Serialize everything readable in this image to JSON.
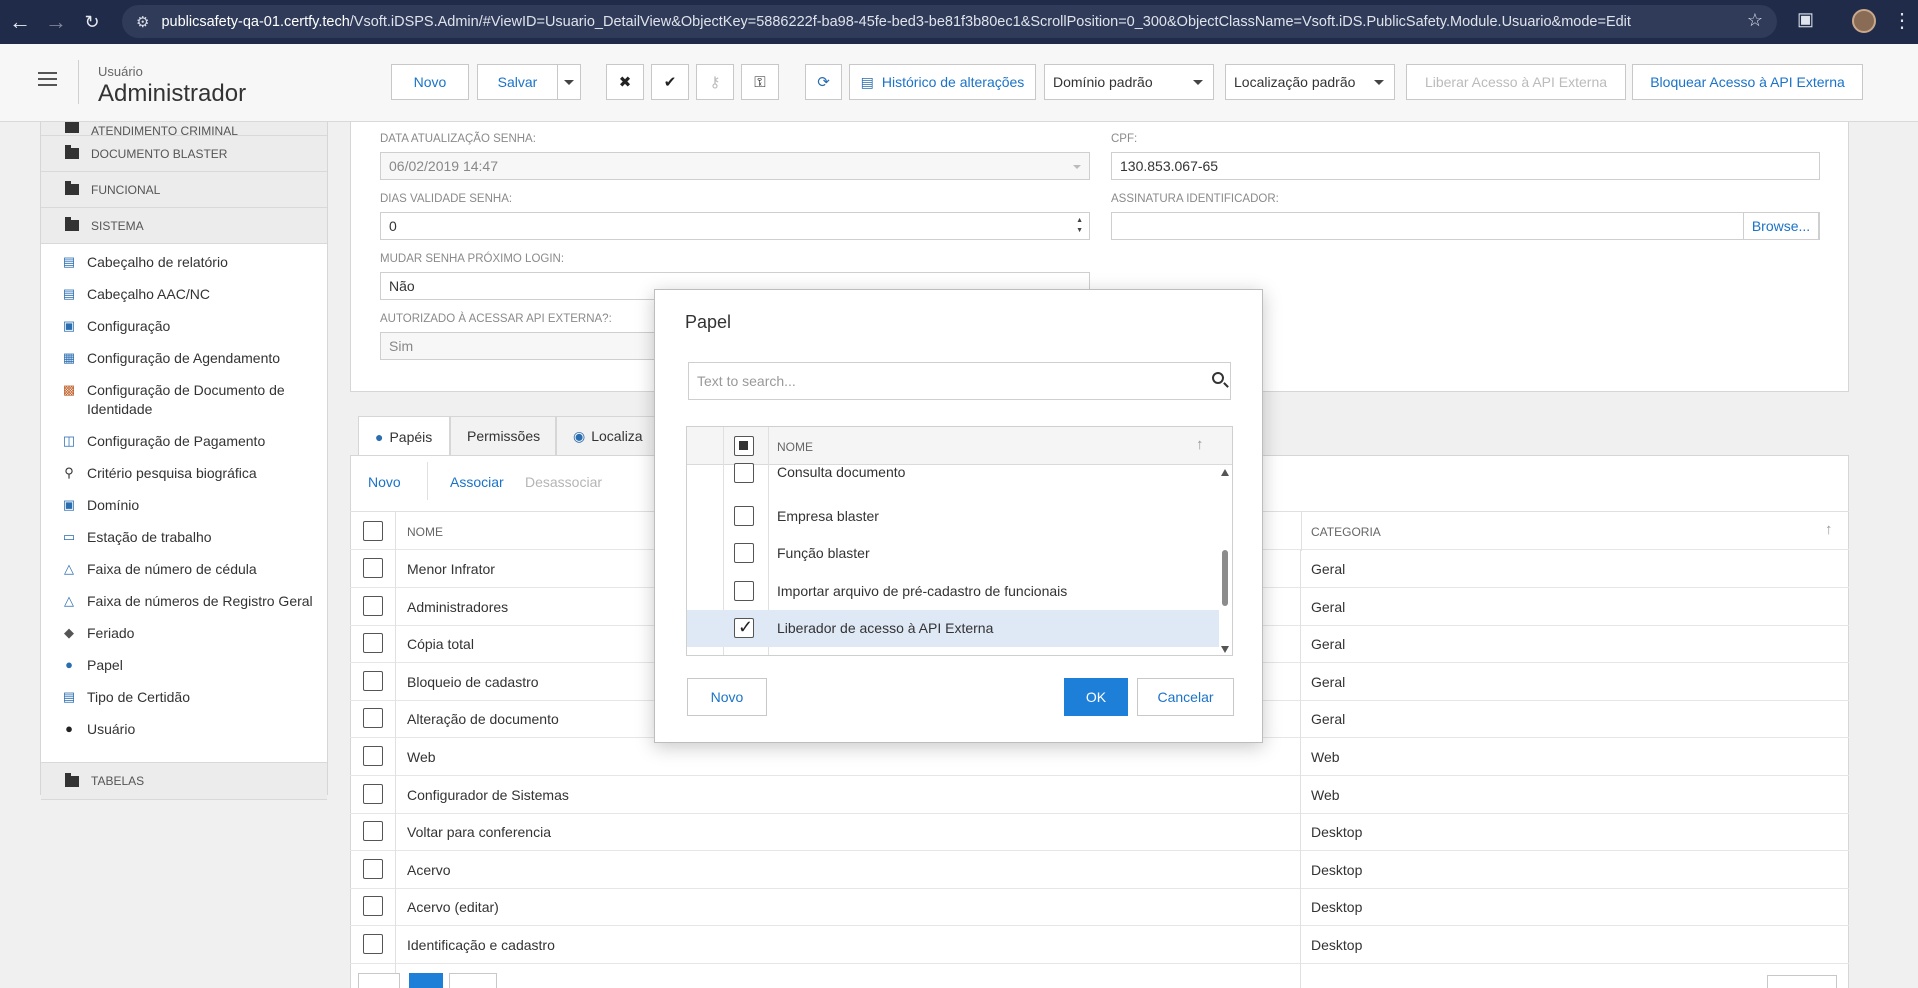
{
  "browser": {
    "url_host": "publicsafety-qa-01.certfy.tech",
    "url_path": "/Vsoft.iDSPS.Admin/#ViewID=Usuario_DetailView&ObjectKey=5886222f-ba98-45fe-bed3-be81f3b80ec1&ScrollPosition=0_300&ObjectClassName=Vsoft.iDS.PublicSafety.Module.Usuario&mode=Edit"
  },
  "header": {
    "breadcrumb_sub": "Usuário",
    "title": "Administrador",
    "novo": "Novo",
    "salvar": "Salvar",
    "historico": "Histórico de alterações",
    "dominio": "Domínio padrão",
    "localizacao": "Localização padrão",
    "liberar": "Liberar Acesso à API Externa",
    "bloquear": "Bloquear Acesso à API Externa"
  },
  "sidebar": {
    "groups": [
      "ATENDIMENTO CRIMINAL",
      "DOCUMENTO BLASTER",
      "FUNCIONAL",
      "SISTEMA",
      "TABELAS"
    ],
    "items": [
      {
        "label": "Cabeçalho de relatório",
        "icon": "report-icon"
      },
      {
        "label": "Cabeçalho AAC/NC",
        "icon": "report-icon"
      },
      {
        "label": "Configuração",
        "icon": "config-icon"
      },
      {
        "label": "Configuração de Agendamento",
        "icon": "calendar-icon"
      },
      {
        "label": "Configuração de Documento de Identidade",
        "icon": "document-icon"
      },
      {
        "label": "Configuração de Pagamento",
        "icon": "payment-icon"
      },
      {
        "label": "Critério pesquisa biográfica",
        "icon": "search-icon"
      },
      {
        "label": "Domínio",
        "icon": "domain-icon"
      },
      {
        "label": "Estação de trabalho",
        "icon": "workstation-icon"
      },
      {
        "label": "Faixa de número de cédula",
        "icon": "range-icon"
      },
      {
        "label": "Faixa de números de Registro Geral",
        "icon": "range-icon"
      },
      {
        "label": "Feriado",
        "icon": "holiday-icon"
      },
      {
        "label": "Papel",
        "icon": "role-icon"
      },
      {
        "label": "Tipo de Certidão",
        "icon": "certificate-icon"
      },
      {
        "label": "Usuário",
        "icon": "user-icon"
      }
    ]
  },
  "form": {
    "data_atualizacao_label": "DATA ATUALIZAÇÃO SENHA:",
    "data_atualizacao_value": "06/02/2019 14:47",
    "cpf_label": "CPF:",
    "cpf_value": "130.853.067-65",
    "dias_label": "DIAS VALIDADE SENHA:",
    "dias_value": "0",
    "assinatura_label": "ASSINATURA IDENTIFICADOR:",
    "assinatura_value": "",
    "browse": "Browse...",
    "mudar_label": "MUDAR SENHA PRÓXIMO LOGIN:",
    "mudar_value": "Não",
    "autorizado_label": "AUTORIZADO À ACESSAR API EXTERNA?:",
    "autorizado_value": "Sim"
  },
  "tabs": [
    "Papéis",
    "Permissões",
    "Localiza"
  ],
  "grid_actions": {
    "novo": "Novo",
    "associar": "Associar",
    "desassociar": "Desassociar"
  },
  "grid": {
    "col_nome": "NOME",
    "col_categoria": "CATEGORIA",
    "rows": [
      {
        "nome": "Menor Infrator",
        "categoria": "Geral"
      },
      {
        "nome": "Administradores",
        "categoria": "Geral"
      },
      {
        "nome": "Cópia total",
        "categoria": "Geral"
      },
      {
        "nome": "Bloqueio de cadastro",
        "categoria": "Geral"
      },
      {
        "nome": "Alteração de documento",
        "categoria": "Geral"
      },
      {
        "nome": "Web",
        "categoria": "Web"
      },
      {
        "nome": "Configurador de Sistemas",
        "categoria": "Web"
      },
      {
        "nome": "Voltar para conferencia",
        "categoria": "Desktop"
      },
      {
        "nome": "Acervo",
        "categoria": "Desktop"
      },
      {
        "nome": "Acervo (editar)",
        "categoria": "Desktop"
      },
      {
        "nome": "Identificação e cadastro",
        "categoria": "Desktop"
      }
    ]
  },
  "dialog": {
    "title": "Papel",
    "search_placeholder": "Text to search...",
    "col_nome": "NOME",
    "rows": [
      {
        "nome": "Consulta documento",
        "checked": false
      },
      {
        "nome": "Empresa blaster",
        "checked": false
      },
      {
        "nome": "Função blaster",
        "checked": false
      },
      {
        "nome": "Importar arquivo de pré-cadastro de funcionais",
        "checked": false
      },
      {
        "nome": "Liberador de acesso à API Externa",
        "checked": true
      }
    ],
    "novo": "Novo",
    "ok": "OK",
    "cancelar": "Cancelar"
  },
  "colors": {
    "accent": "#1e7fd9",
    "link": "#1a73c8",
    "selected_row": "#dfe9f6"
  }
}
